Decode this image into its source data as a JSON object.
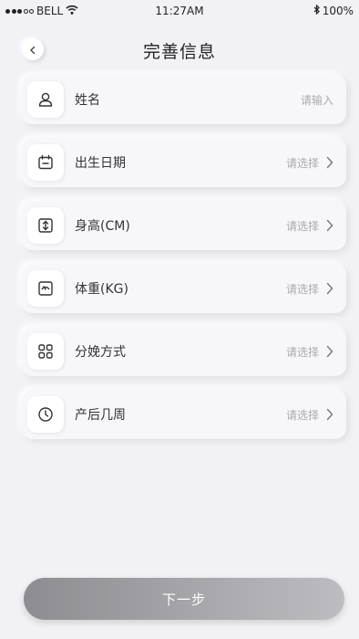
{
  "status_bar": {
    "carrier": "BELL",
    "time": "11:27AM",
    "battery": "100%",
    "icons": [
      "signal-icon",
      "wifi-icon",
      "bluetooth-icon",
      "battery-icon"
    ]
  },
  "header": {
    "title": "完善信息",
    "back_icon": "chevron-left-icon"
  },
  "form": {
    "rows": [
      {
        "label": "姓名",
        "placeholder": "请输入",
        "icon": "person-icon",
        "chevron": false
      },
      {
        "label": "出生日期",
        "placeholder": "请选择",
        "icon": "calendar-icon",
        "chevron": true
      },
      {
        "label": "身高(CM)",
        "placeholder": "请选择",
        "icon": "height-icon",
        "chevron": true
      },
      {
        "label": "体重(KG)",
        "placeholder": "请选择",
        "icon": "scale-icon",
        "chevron": true
      },
      {
        "label": "分娩方式",
        "placeholder": "请选择",
        "icon": "grid-icon",
        "chevron": true
      },
      {
        "label": "产后几周",
        "placeholder": "请选择",
        "icon": "clock-icon",
        "chevron": true
      }
    ]
  },
  "footer": {
    "next_label": "下一步"
  },
  "colors": {
    "background": "#f2f2f6",
    "button_gradient_start": "#8c8c91",
    "button_gradient_end": "#bcbcc1",
    "placeholder_text": "#aaaaaa"
  }
}
